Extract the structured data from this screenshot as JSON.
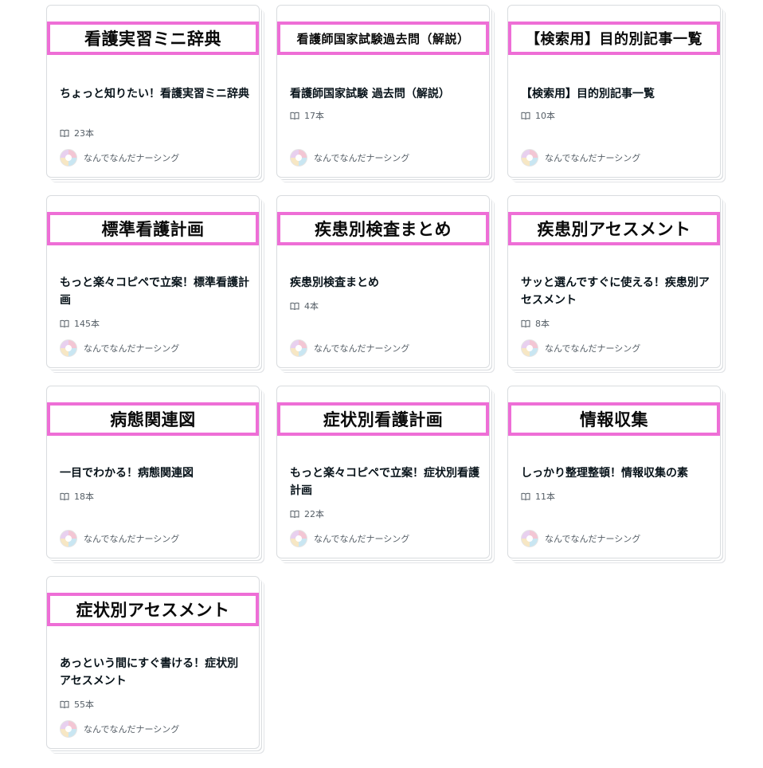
{
  "author_name": "なんでなんだナーシング",
  "cards": [
    {
      "banner": "看護実習ミニ辞典",
      "title": "ちょっと知りたい！看護実習ミニ辞典",
      "count": "23本"
    },
    {
      "banner": "看護師国家試験過去問（解説）",
      "title": "看護師国家試験 過去問（解説）",
      "count": "17本"
    },
    {
      "banner": "【検索用】目的別記事一覧",
      "title": "【検索用】目的別記事一覧",
      "count": "10本"
    },
    {
      "banner": "標準看護計画",
      "title": "もっと楽々コピペで立案！標準看護計画",
      "count": "145本"
    },
    {
      "banner": "疾患別検査まとめ",
      "title": "疾患別検査まとめ",
      "count": "4本"
    },
    {
      "banner": "疾患別アセスメント",
      "title": "サッと選んですぐに使える！疾患別アセスメント",
      "count": "8本"
    },
    {
      "banner": "病態関連図",
      "title": "一目でわかる！病態関連図",
      "count": "18本"
    },
    {
      "banner": "症状別看護計画",
      "title": "もっと楽々コピペで立案！症状別看護計画",
      "count": "22本"
    },
    {
      "banner": "情報収集",
      "title": "しっかり整理整頓！情報収集の素",
      "count": "11本"
    },
    {
      "banner": "症状別アセスメント",
      "title": "あっという間にすぐ書ける！症状別アセスメント",
      "count": "55本"
    }
  ]
}
